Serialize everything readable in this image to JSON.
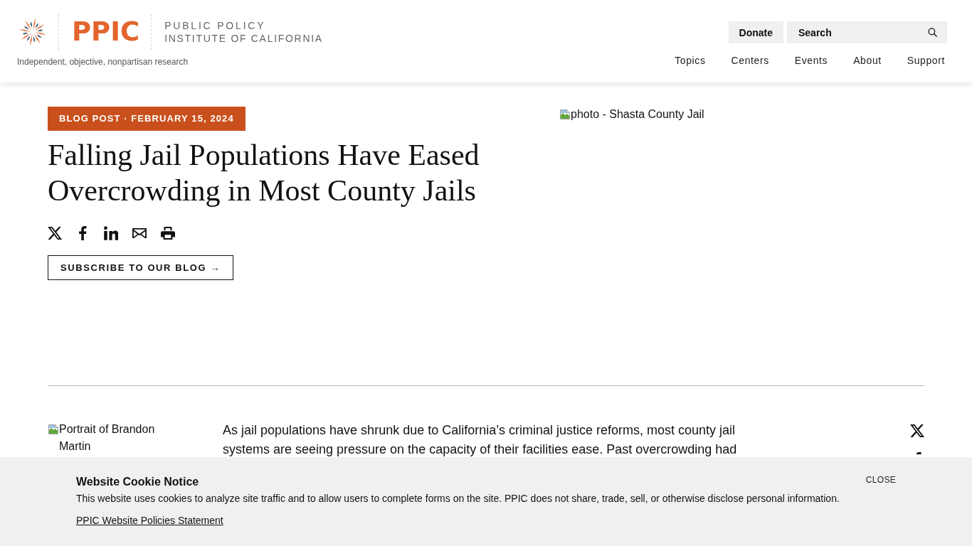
{
  "header": {
    "logo": {
      "mark": "PPIC",
      "name_lines": [
        "PUBLIC POLICY",
        "INSTITUTE OF CALIFORNIA"
      ]
    },
    "tagline": "Independent, objective, nonpartisan research",
    "donate_button": "Donate",
    "search": {
      "placeholder": "Search"
    },
    "nav": [
      "Topics",
      "Centers",
      "Events",
      "About",
      "Support"
    ]
  },
  "article": {
    "badge": "BLOG POST · FEBRUARY 15, 2024",
    "title": "Falling Jail Populations Have Eased Overcrowding in Most County Jails",
    "subscribe_button": "SUBSCRIBE TO OUR BLOG →",
    "hero_image": {
      "alt": "photo - Shasta County Jail"
    },
    "author_image": {
      "alt": "Portrait of Brandon Martin"
    },
    "body": "As jail populations have shrunk due to California’s criminal justice reforms, most county jail systems are seeing pressure on the capacity of their facilities ease. Past overcrowding had"
  },
  "cookie_notice": {
    "title": "Website Cookie Notice",
    "text": "This website uses cookies to analyze site traffic and to allow users to complete forms on the site. PPIC does not share, trade, sell, or otherwise disclose personal information.",
    "link": "PPIC Website Policies Statement",
    "close": "CLOSE"
  }
}
